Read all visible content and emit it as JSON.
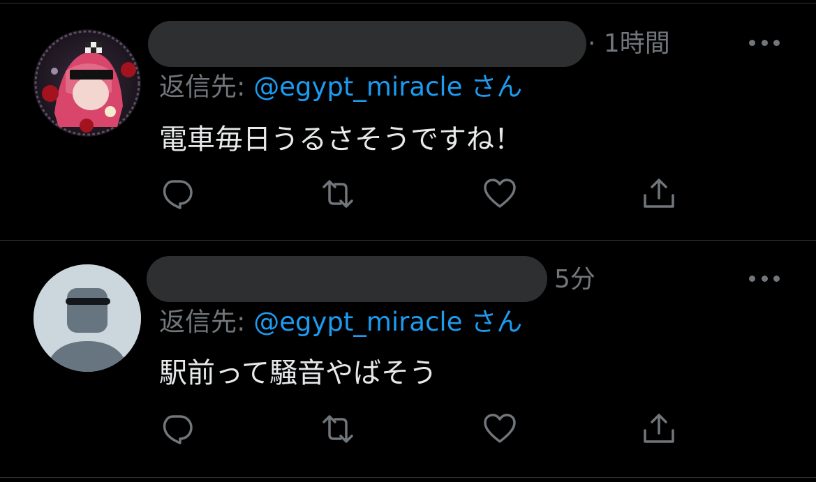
{
  "tweets": [
    {
      "time": "· 1時間",
      "reply_prefix": "返信先: ",
      "reply_handle": "@egypt_miracle",
      "reply_suffix": " さん",
      "text": "電車毎日うるさそうですね！",
      "avatar": "anime-avatar"
    },
    {
      "time": "5分",
      "reply_prefix": "返信先: ",
      "reply_handle": "@egypt_miracle",
      "reply_suffix": " さん",
      "text": "駅前って騒音やばそう",
      "avatar": "default-avatar"
    }
  ],
  "icons": {
    "more": "more-icon",
    "reply": "reply-icon",
    "retweet": "retweet-icon",
    "like": "heart-icon",
    "share": "share-icon"
  },
  "colors": {
    "background": "#000000",
    "text": "#e7e9ea",
    "secondary": "#71767b",
    "mention": "#1d9bf0",
    "divider": "#2f3336"
  }
}
